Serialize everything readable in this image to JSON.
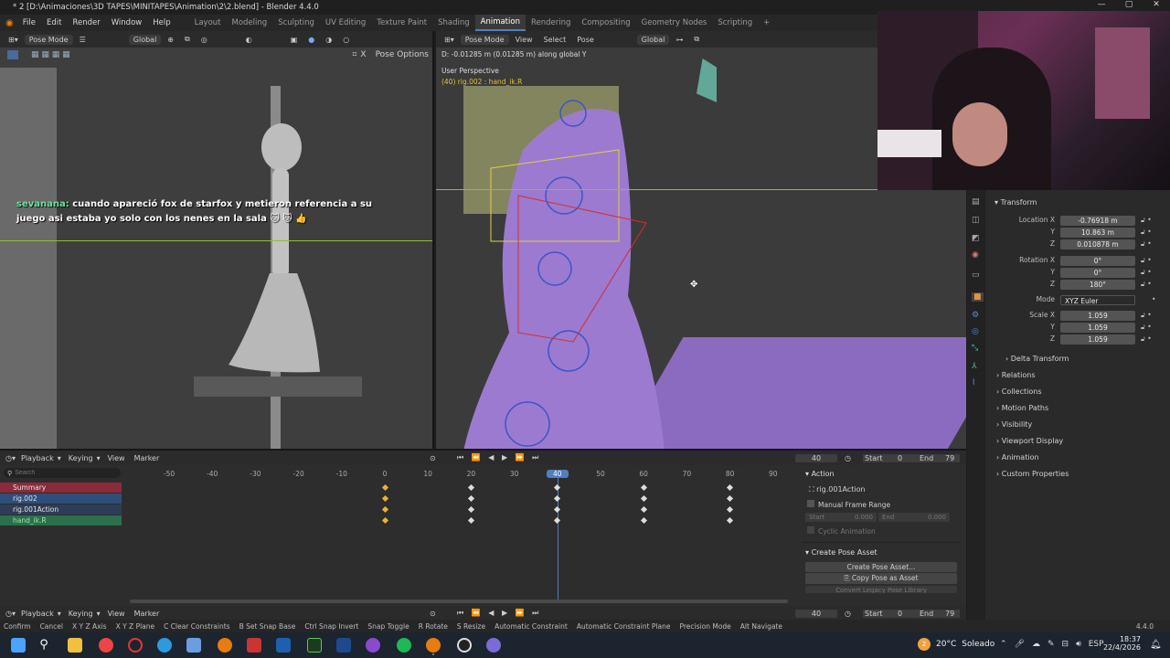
{
  "window": {
    "title": "* 2 [D:\\Animaciones\\3D TAPES\\MINITAPES\\Animation\\2\\2.blend] - Blender 4.4.0",
    "minimize": "—",
    "maximize": "▢",
    "close": "✕"
  },
  "menus": [
    "File",
    "Edit",
    "Render",
    "Window",
    "Help"
  ],
  "workspaces": [
    {
      "label": "Layout"
    },
    {
      "label": "Modeling"
    },
    {
      "label": "Sculpting"
    },
    {
      "label": "UV Editing"
    },
    {
      "label": "Texture Paint"
    },
    {
      "label": "Shading"
    },
    {
      "label": "Animation",
      "active": true
    },
    {
      "label": "Rendering"
    },
    {
      "label": "Compositing"
    },
    {
      "label": "Geometry Nodes"
    },
    {
      "label": "Scripting"
    }
  ],
  "add_workspace": "+",
  "left_viewport": {
    "mode": "Pose Mode",
    "orientation": "Global",
    "pose_options": "Pose Options",
    "chat_user": "sevanana:",
    "chat_text": "cuando apareció fox de starfox y metieron referencia a su juego asi estaba yo solo con los nenes en la sala",
    "chat_emoji": "🐱 🐱 👍",
    "axis_x": "X"
  },
  "right_viewport": {
    "mode": "Pose Mode",
    "menus": [
      "View",
      "Select",
      "Pose"
    ],
    "orientation": "Global",
    "transform_info": "D: -0.01285 m (0.01285 m) along global Y",
    "view_name": "User Perspective",
    "selection": "(40) rig.002 : hand_ik.R"
  },
  "properties": {
    "transform_title": "Transform",
    "location": {
      "label": "Location X",
      "x": "-0.76918 m",
      "y": "10.863 m",
      "z": "0.010878 m"
    },
    "rotation": {
      "label": "Rotation X",
      "x": "0°",
      "y": "0°",
      "z": "180°"
    },
    "mode_label": "Mode",
    "mode_value": "XYZ Euler",
    "scale": {
      "label": "Scale X",
      "x": "1.059",
      "y": "1.059",
      "z": "1.059"
    },
    "y": "Y",
    "z": "Z",
    "delta": "Delta Transform",
    "sections": [
      "Relations",
      "Collections",
      "Motion Paths",
      "Visibility",
      "Viewport Display",
      "Animation",
      "Custom Properties"
    ]
  },
  "timeline": {
    "playback": "Playback",
    "keying": "Keying",
    "view": "View",
    "marker": "Marker",
    "current_frame": "40",
    "start_label": "Start",
    "start": "0",
    "end_label": "End",
    "end": "79",
    "search_placeholder": "Search",
    "channels": [
      {
        "label": "Summary",
        "color": "#8a2a3a"
      },
      {
        "label": "rig.002",
        "color": "#2f4f7a"
      },
      {
        "label": "rig.001Action",
        "color": "#2d3d55"
      },
      {
        "label": "hand_ik.R",
        "color": "#2d6e4d"
      }
    ],
    "frames": [
      "-50",
      "-40",
      "-30",
      "-20",
      "-10",
      "0",
      "10",
      "20",
      "30",
      "40",
      "50",
      "60",
      "70",
      "80",
      "90"
    ],
    "keyframes": [
      0,
      20,
      40,
      60,
      80
    ],
    "action_panel": {
      "title": "Action",
      "action_name": "rig.001Action",
      "manual": "Manual Frame Range",
      "start_label": "Start",
      "start": "0.000",
      "end_label": "End",
      "end": "0.000",
      "cyclic": "Cyclic Animation"
    },
    "pose_panel": {
      "title": "Create Pose Asset",
      "create": "Create Pose Asset...",
      "copy": "Copy Pose as Asset",
      "convert": "Convert Legacy Pose Library"
    }
  },
  "bottom_timeline": {
    "playback": "Playback",
    "keying": "Keying",
    "view": "View",
    "marker": "Marker",
    "current_frame": "40",
    "start_label": "Start",
    "start": "0",
    "end_label": "End",
    "end": "79"
  },
  "statusbar": [
    "Confirm",
    "Cancel",
    "X Y Z Axis",
    "X Y Z Plane",
    "C Clear Constraints",
    "B Set Snap Base",
    "Ctrl Snap Invert",
    "Snap Toggle",
    "R Rotate",
    "S Resize",
    "Automatic Constraint",
    "Automatic Constraint Plane",
    "Precision Mode",
    "Alt Navigate"
  ],
  "version": "4.4.0",
  "taskbar": {
    "weather_temp": "20°C",
    "weather_text": "Soleado",
    "lang": "ESP",
    "time": "18:37",
    "date": "22/4/2026",
    "weather_badge": "2"
  }
}
